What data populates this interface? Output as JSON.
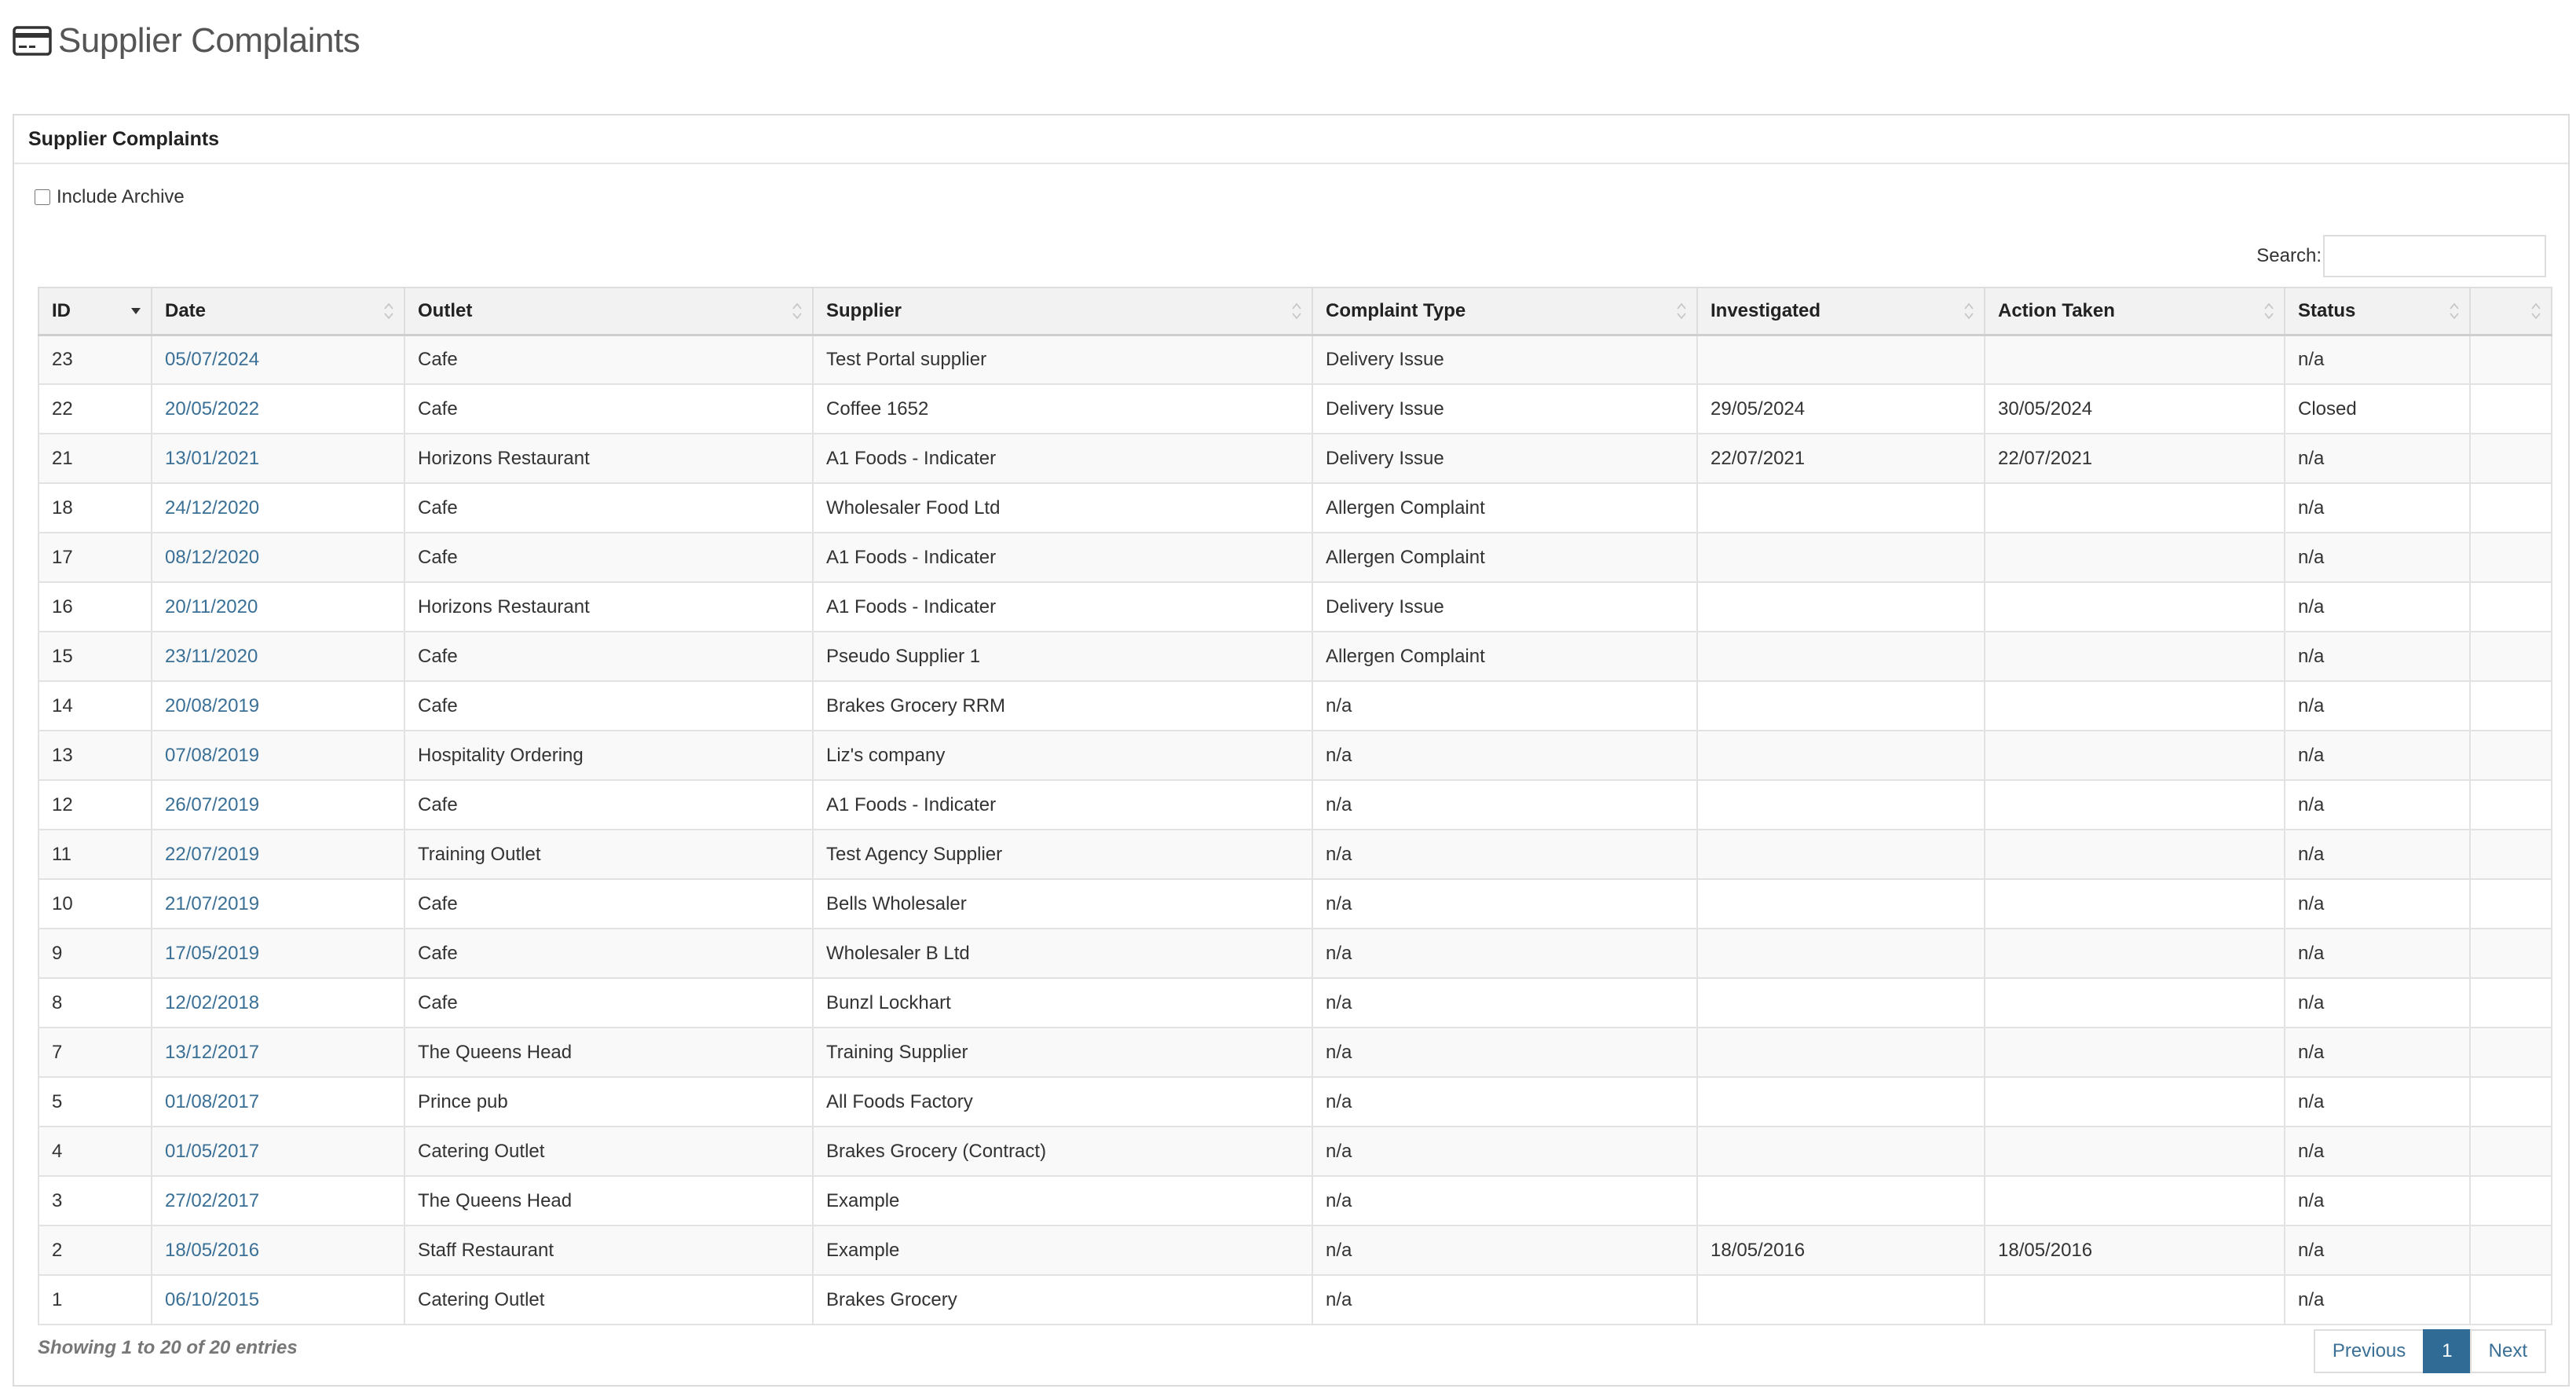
{
  "page": {
    "title": "Supplier Complaints",
    "icon": "credit-card-icon"
  },
  "panel": {
    "heading": "Supplier Complaints"
  },
  "archive": {
    "label": "Include Archive",
    "checked": false
  },
  "search": {
    "label": "Search:",
    "value": ""
  },
  "table": {
    "columns": [
      "ID",
      "Date",
      "Outlet",
      "Supplier",
      "Complaint Type",
      "Investigated",
      "Action Taken",
      "Status",
      ""
    ],
    "rows": [
      {
        "id": "23",
        "date": "05/07/2024",
        "outlet": "Cafe",
        "supplier": "Test Portal supplier",
        "type": "Delivery Issue",
        "investigated": "",
        "action": "",
        "status": "n/a"
      },
      {
        "id": "22",
        "date": "20/05/2022",
        "outlet": "Cafe",
        "supplier": "Coffee 1652",
        "type": "Delivery Issue",
        "investigated": "29/05/2024",
        "action": "30/05/2024",
        "status": "Closed"
      },
      {
        "id": "21",
        "date": "13/01/2021",
        "outlet": "Horizons Restaurant",
        "supplier": "A1 Foods - Indicater",
        "type": "Delivery Issue",
        "investigated": "22/07/2021",
        "action": "22/07/2021",
        "status": "n/a"
      },
      {
        "id": "18",
        "date": "24/12/2020",
        "outlet": "Cafe",
        "supplier": "Wholesaler Food Ltd",
        "type": "Allergen Complaint",
        "investigated": "",
        "action": "",
        "status": "n/a"
      },
      {
        "id": "17",
        "date": "08/12/2020",
        "outlet": "Cafe",
        "supplier": "A1 Foods - Indicater",
        "type": "Allergen Complaint",
        "investigated": "",
        "action": "",
        "status": "n/a"
      },
      {
        "id": "16",
        "date": "20/11/2020",
        "outlet": "Horizons Restaurant",
        "supplier": "A1 Foods - Indicater",
        "type": "Delivery Issue",
        "investigated": "",
        "action": "",
        "status": "n/a"
      },
      {
        "id": "15",
        "date": "23/11/2020",
        "outlet": "Cafe",
        "supplier": "Pseudo Supplier 1",
        "type": "Allergen Complaint",
        "investigated": "",
        "action": "",
        "status": "n/a"
      },
      {
        "id": "14",
        "date": "20/08/2019",
        "outlet": "Cafe",
        "supplier": "Brakes Grocery RRM",
        "type": "n/a",
        "investigated": "",
        "action": "",
        "status": "n/a"
      },
      {
        "id": "13",
        "date": "07/08/2019",
        "outlet": "Hospitality Ordering",
        "supplier": "Liz's company",
        "type": "n/a",
        "investigated": "",
        "action": "",
        "status": "n/a"
      },
      {
        "id": "12",
        "date": "26/07/2019",
        "outlet": "Cafe",
        "supplier": "A1 Foods - Indicater",
        "type": "n/a",
        "investigated": "",
        "action": "",
        "status": "n/a"
      },
      {
        "id": "11",
        "date": "22/07/2019",
        "outlet": "Training Outlet",
        "supplier": "Test Agency Supplier",
        "type": "n/a",
        "investigated": "",
        "action": "",
        "status": "n/a"
      },
      {
        "id": "10",
        "date": "21/07/2019",
        "outlet": "Cafe",
        "supplier": "Bells Wholesaler",
        "type": "n/a",
        "investigated": "",
        "action": "",
        "status": "n/a"
      },
      {
        "id": "9",
        "date": "17/05/2019",
        "outlet": "Cafe",
        "supplier": "Wholesaler B Ltd",
        "type": "n/a",
        "investigated": "",
        "action": "",
        "status": "n/a"
      },
      {
        "id": "8",
        "date": "12/02/2018",
        "outlet": "Cafe",
        "supplier": "Bunzl Lockhart",
        "type": "n/a",
        "investigated": "",
        "action": "",
        "status": "n/a"
      },
      {
        "id": "7",
        "date": "13/12/2017",
        "outlet": "The Queens Head",
        "supplier": "Training Supplier",
        "type": "n/a",
        "investigated": "",
        "action": "",
        "status": "n/a"
      },
      {
        "id": "5",
        "date": "01/08/2017",
        "outlet": "Prince pub",
        "supplier": "All Foods Factory",
        "type": "n/a",
        "investigated": "",
        "action": "",
        "status": "n/a"
      },
      {
        "id": "4",
        "date": "01/05/2017",
        "outlet": "Catering Outlet",
        "supplier": "Brakes Grocery (Contract)",
        "type": "n/a",
        "investigated": "",
        "action": "",
        "status": "n/a"
      },
      {
        "id": "3",
        "date": "27/02/2017",
        "outlet": "The Queens Head",
        "supplier": "Example",
        "type": "n/a",
        "investigated": "",
        "action": "",
        "status": "n/a"
      },
      {
        "id": "2",
        "date": "18/05/2016",
        "outlet": "Staff Restaurant",
        "supplier": "Example",
        "type": "n/a",
        "investigated": "18/05/2016",
        "action": "18/05/2016",
        "status": "n/a"
      },
      {
        "id": "1",
        "date": "06/10/2015",
        "outlet": "Catering Outlet",
        "supplier": "Brakes Grocery",
        "type": "n/a",
        "investigated": "",
        "action": "",
        "status": "n/a"
      }
    ]
  },
  "footer": {
    "info": "Showing 1 to 20 of 20 entries",
    "previous": "Previous",
    "page": "1",
    "next": "Next"
  },
  "colors": {
    "link": "#3a6f96",
    "active_page": "#2f6b94"
  }
}
